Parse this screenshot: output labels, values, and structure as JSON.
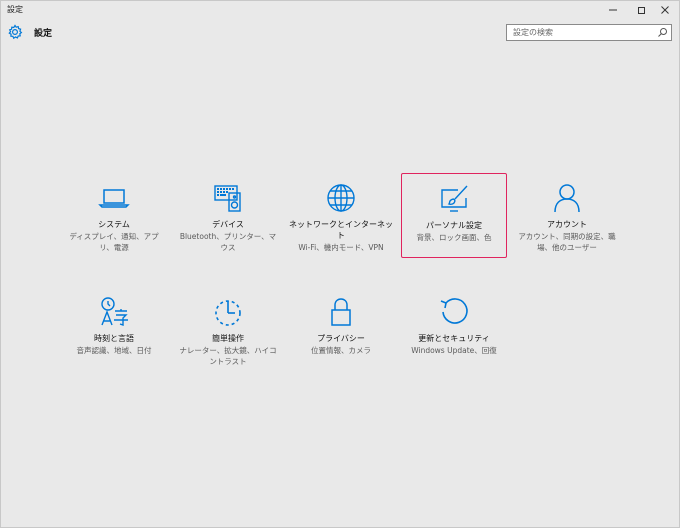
{
  "window": {
    "title": "設定"
  },
  "header": {
    "title": "設定",
    "icon": "gear-icon"
  },
  "search": {
    "placeholder": "設定の検索"
  },
  "accent_color": "#0078d7",
  "highlight_color": "#e0245e",
  "tiles": [
    {
      "label": "システム",
      "desc": "ディスプレイ、通知、アプリ、電源",
      "icon": "laptop-icon"
    },
    {
      "label": "デバイス",
      "desc": "Bluetooth、プリンター、マウス",
      "icon": "keyboard-speaker-icon"
    },
    {
      "label": "ネットワークとインターネット",
      "desc": "Wi-Fi、機内モード、VPN",
      "icon": "globe-icon"
    },
    {
      "label": "パーソナル設定",
      "desc": "背景、ロック画面、色",
      "icon": "paintbrush-monitor-icon",
      "selected": true
    },
    {
      "label": "アカウント",
      "desc": "アカウント、同期の設定、職場、他のユーザー",
      "icon": "person-icon"
    },
    {
      "label": "時刻と言語",
      "desc": "音声認識、地域、日付",
      "icon": "language-icon"
    },
    {
      "label": "簡単操作",
      "desc": "ナレーター、拡大鏡、ハイコントラスト",
      "icon": "accessibility-timer-icon"
    },
    {
      "label": "プライバシー",
      "desc": "位置情報、カメラ",
      "icon": "lock-icon"
    },
    {
      "label": "更新とセキュリティ",
      "desc": "Windows Update、回復",
      "icon": "refresh-icon"
    }
  ]
}
